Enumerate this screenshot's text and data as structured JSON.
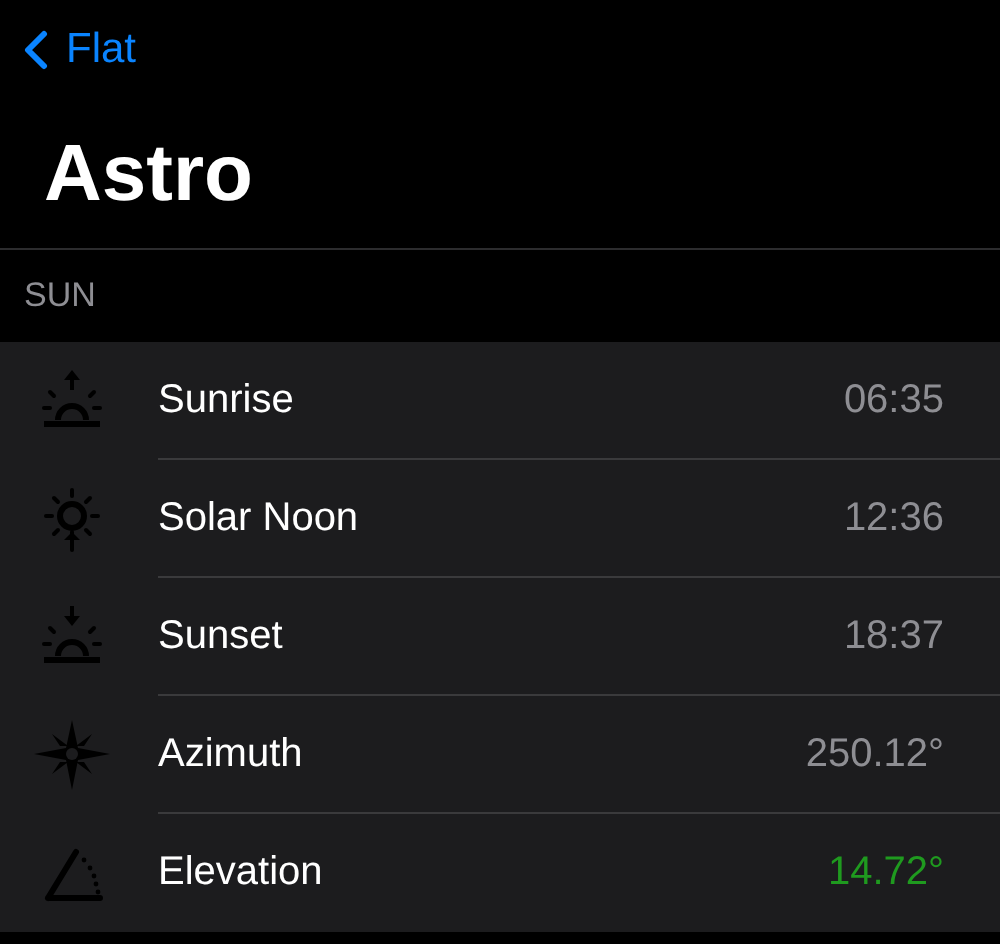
{
  "nav": {
    "back_label": "Flat",
    "title": "Astro"
  },
  "section": {
    "header": "SUN",
    "rows": [
      {
        "kind": "sunrise",
        "label": "Sunrise",
        "value": "06:35",
        "color": "#8e8e93"
      },
      {
        "kind": "noon",
        "label": "Solar Noon",
        "value": "12:36",
        "color": "#8e8e93"
      },
      {
        "kind": "sunset",
        "label": "Sunset",
        "value": "18:37",
        "color": "#8e8e93"
      },
      {
        "kind": "azimuth",
        "label": "Azimuth",
        "value": "250.12°",
        "color": "#8e8e93"
      },
      {
        "kind": "elevation",
        "label": "Elevation",
        "value": "14.72°",
        "color": "#1f9a1f"
      }
    ]
  }
}
